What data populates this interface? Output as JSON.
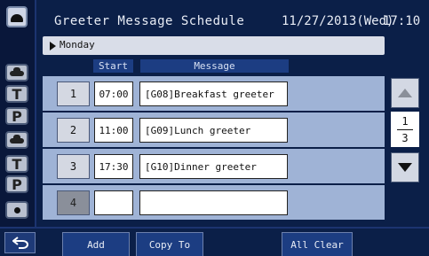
{
  "header": {
    "title": "Greeter Message Schedule",
    "date": "11/27/2013(Wed)",
    "time": "17:10"
  },
  "day_selector": {
    "label": "Monday"
  },
  "columns": {
    "start": "Start",
    "message": "Message"
  },
  "rows": [
    {
      "number": "1",
      "start": "07:00",
      "message": "[G08]Breakfast greeter"
    },
    {
      "number": "2",
      "start": "11:00",
      "message": "[G09]Lunch greeter"
    },
    {
      "number": "3",
      "start": "17:30",
      "message": "[G10]Dinner greeter"
    },
    {
      "number": "4",
      "start": "",
      "message": ""
    }
  ],
  "pager": {
    "current": "1",
    "total": "3"
  },
  "rail": {
    "t1": "T",
    "p1": "P",
    "t2": "T",
    "p2": "P"
  },
  "footer": {
    "add": "Add",
    "copy_to": "Copy To",
    "all_clear": "All Clear"
  },
  "colors": {
    "background": "#0b1f48",
    "row": "#9fb3d6",
    "header_accent": "#1c3d82"
  }
}
